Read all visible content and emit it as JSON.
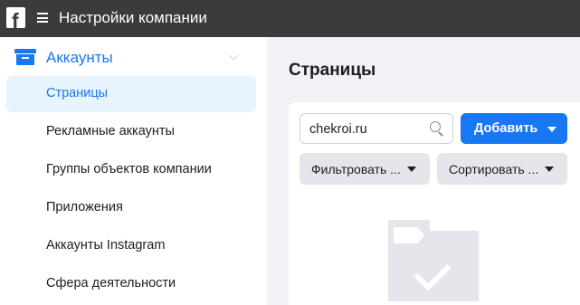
{
  "topbar": {
    "logo": "f",
    "title": "Настройки компании"
  },
  "sidebar": {
    "section": {
      "label": "Аккаунты"
    },
    "items": [
      {
        "label": "Страницы"
      },
      {
        "label": "Рекламные аккаунты"
      },
      {
        "label": "Группы объектов компании"
      },
      {
        "label": "Приложения"
      },
      {
        "label": "Аккаунты Instagram"
      },
      {
        "label": "Сфера деятельности"
      }
    ]
  },
  "main": {
    "title": "Страницы",
    "search": {
      "value": "chekroi.ru"
    },
    "add_button": "Добавить",
    "filter_button": "Фильтровать ...",
    "sort_button": "Сортировать ..."
  },
  "colors": {
    "accent": "#1877f2",
    "topbar": "#3a3b3c",
    "active_bg": "#e7f3ff",
    "panel_bg": "#f0f2f5"
  },
  "icons": [
    "facebook-logo",
    "hamburger-menu-icon",
    "briefcase-icon",
    "chevron-down-icon",
    "search-icon",
    "caret-down-icon",
    "empty-folder-illustration"
  ]
}
